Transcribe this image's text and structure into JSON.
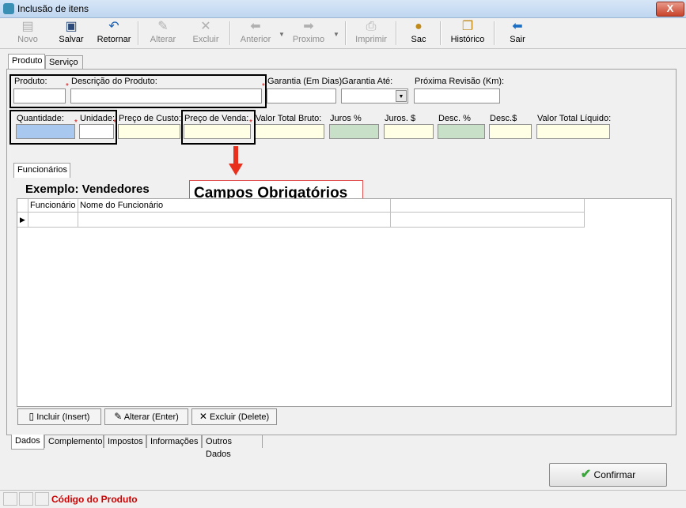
{
  "window": {
    "title": "Inclusão de itens",
    "close_glyph": "X"
  },
  "toolbar": {
    "buttons": [
      {
        "label": "Novo",
        "icon": "new-doc-icon",
        "enabled": false
      },
      {
        "label": "Salvar",
        "icon": "floppy-icon",
        "enabled": true
      },
      {
        "label": "Retornar",
        "icon": "undo-icon",
        "enabled": true
      },
      {
        "label": "Alterar",
        "icon": "edit-icon",
        "enabled": false
      },
      {
        "label": "Excluir",
        "icon": "delete-icon",
        "enabled": false
      },
      {
        "label": "Anterior",
        "icon": "arrow-left-icon",
        "enabled": false
      },
      {
        "label": "Proximo",
        "icon": "arrow-right-icon",
        "enabled": false
      },
      {
        "label": "Imprimir",
        "icon": "printer-icon",
        "enabled": false
      },
      {
        "label": "Sac",
        "icon": "user-icon",
        "enabled": true
      },
      {
        "label": "Histórico",
        "icon": "folder-open-icon",
        "enabled": true
      },
      {
        "label": "Sair",
        "icon": "exit-arrow-icon",
        "enabled": true
      }
    ]
  },
  "top_tabs": [
    "Produto",
    "Serviço"
  ],
  "fields_row1": {
    "produto": "Produto:",
    "descricao": "Descrição do Produto:",
    "garantia_dias": "Garantia (Em Dias):",
    "garantia_ate": "Garantia Até:",
    "proxima_revisao": "Próxima Revisão (Km):"
  },
  "fields_row2": {
    "quantidade": "Quantidade:",
    "unidade": "Unidade:",
    "preco_custo": "Preço de Custo:",
    "preco_venda": "Preço de Venda:",
    "valor_total_bruto": "Valor Total Bruto:",
    "juros_pct": "Juros %",
    "juros_val": "Juros. $",
    "desc_pct": "Desc. %",
    "desc_val": "Desc.$",
    "valor_total_liquido": "Valor Total Líquido:"
  },
  "required_mark": "*",
  "inner_tab": "Funcionários",
  "annotation": {
    "example": "Exemplo: Vendedores",
    "required_fields": "Campos Obrigatórios"
  },
  "grid": {
    "columns": [
      "Funcionário",
      "Nome do Funcionário"
    ],
    "row_indicator": "▶"
  },
  "grid_buttons": [
    "Incluir (Insert)",
    "Alterar (Enter)",
    "Excluir (Delete)"
  ],
  "bottom_tabs": [
    "Dados",
    "Complemento",
    "Impostos",
    "Informações",
    "Outros Dados"
  ],
  "confirm_label": "Confirmar",
  "status_text": "Código do Produto",
  "colors": {
    "quantity_bg": "#a8c8f0",
    "readonly_bg": "#ffffe6",
    "green_bg": "#c8e0c8",
    "status_red": "#cc0000",
    "arrow_red": "#e8301c"
  }
}
